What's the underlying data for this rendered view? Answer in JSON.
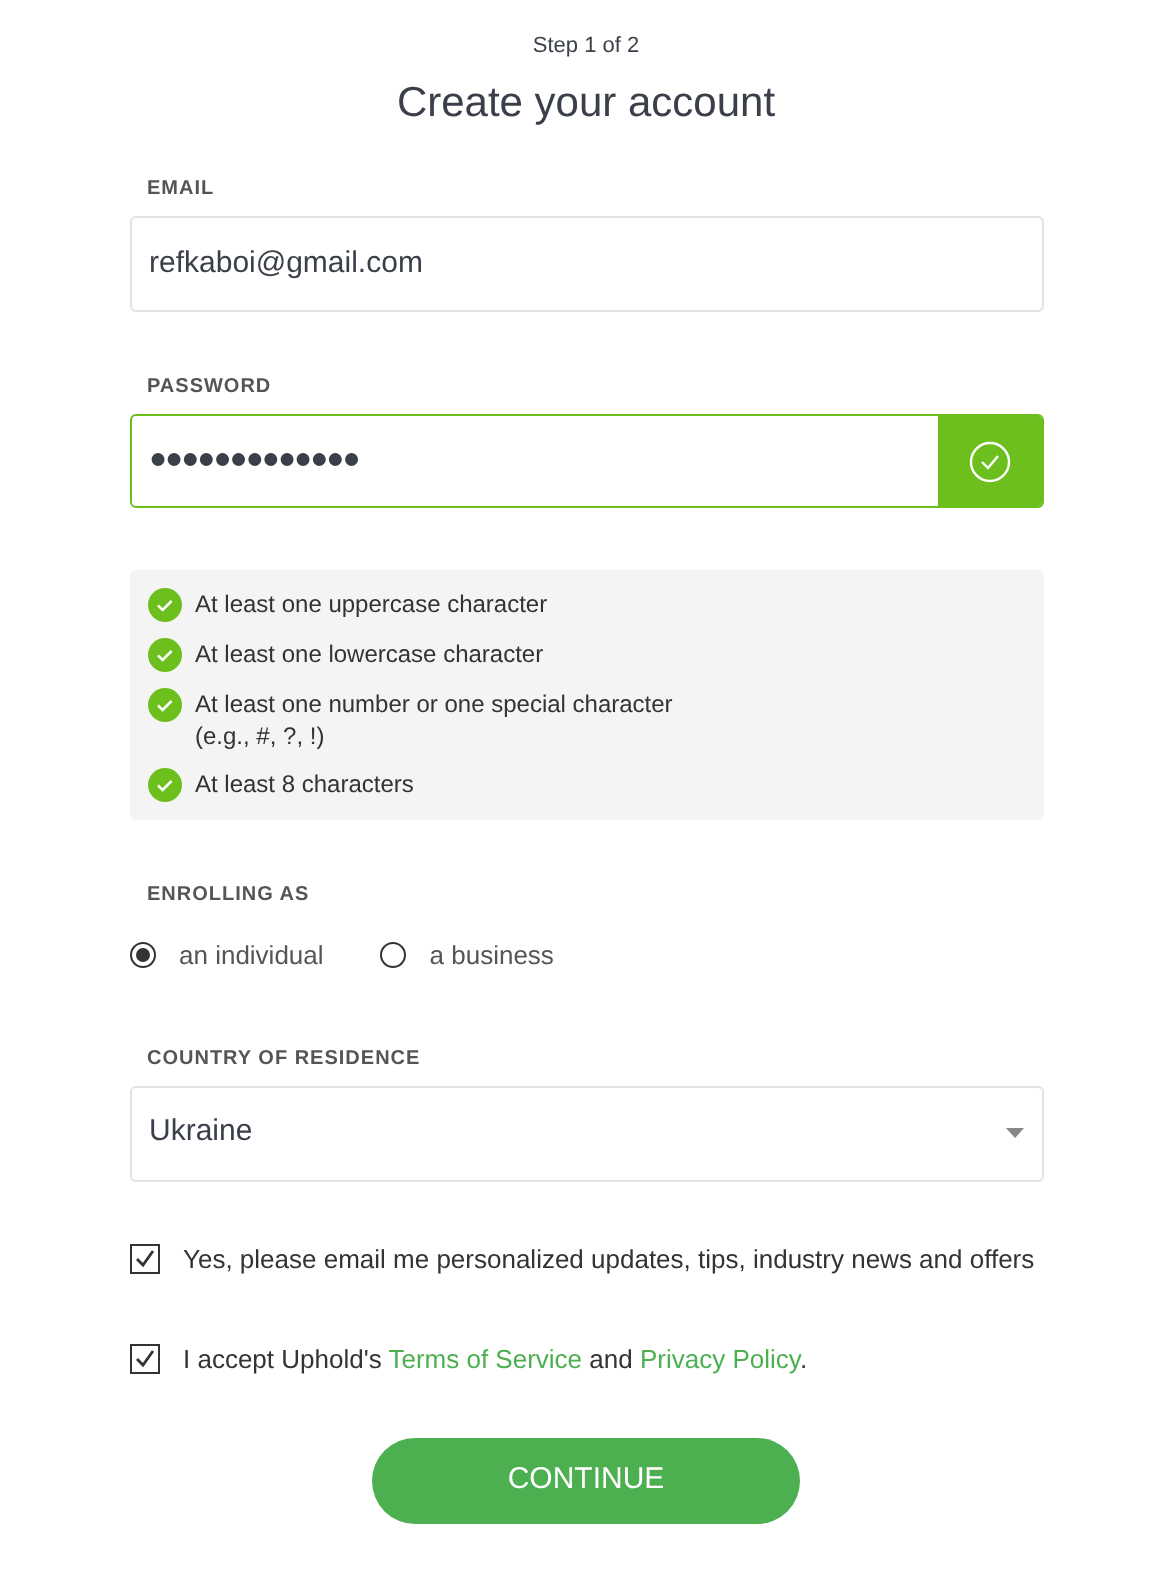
{
  "step": "Step 1 of 2",
  "title": "Create your account",
  "email": {
    "label": "EMAIL",
    "value": "refkaboi@gmail.com"
  },
  "password": {
    "label": "PASSWORD",
    "value": "●●●●●●●●●●●●●",
    "valid": true
  },
  "requirements": [
    {
      "text": "At least one uppercase character",
      "met": true
    },
    {
      "text": "At least one lowercase character",
      "met": true
    },
    {
      "text": "At least one number or one special character",
      "note": "(e.g., #, ?, !)",
      "met": true
    },
    {
      "text": "At least 8 characters",
      "met": true
    }
  ],
  "enrolling": {
    "label": "ENROLLING AS",
    "options": [
      {
        "label": "an individual",
        "selected": true
      },
      {
        "label": "a business",
        "selected": false
      }
    ]
  },
  "country": {
    "label": "COUNTRY OF RESIDENCE",
    "value": "Ukraine"
  },
  "newsletter": {
    "label": "Yes, please email me personalized updates, tips, industry news and offers",
    "checked": true
  },
  "terms": {
    "checked": true,
    "before": "I accept Uphold's",
    "terms_link": "Terms of Service",
    "middle": "and",
    "privacy_link": "Privacy Policy",
    "end": "."
  },
  "continue_button": "CONTINUE"
}
